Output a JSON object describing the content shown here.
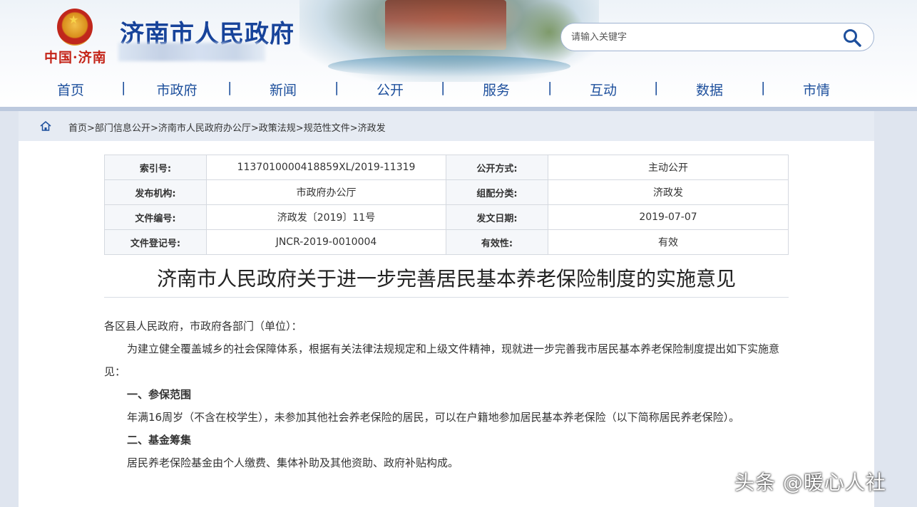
{
  "header": {
    "site_title": "济南市人民政府",
    "logo_text": "中国·济南",
    "search_placeholder": "请输入关键字"
  },
  "nav": {
    "items": [
      "首页",
      "市政府",
      "新闻",
      "公开",
      "服务",
      "互动",
      "数据",
      "市情"
    ],
    "separator": "|"
  },
  "breadcrumb": {
    "items": [
      "首页",
      "部门信息公开",
      "济南市人民政府办公厅",
      "政策法规",
      "规范性文件",
      "济政发"
    ],
    "separator": ">"
  },
  "meta": {
    "rows": [
      {
        "k1": "索引号:",
        "v1": "1137010000418859XL/2019-11319",
        "k2": "公开方式:",
        "v2": "主动公开"
      },
      {
        "k1": "发布机构:",
        "v1": "市政府办公厅",
        "k2": "组配分类:",
        "v2": "济政发"
      },
      {
        "k1": "文件编号:",
        "v1": "济政发〔2019〕11号",
        "k2": "发文日期:",
        "v2": "2019-07-07"
      },
      {
        "k1": "文件登记号:",
        "v1": "JNCR-2019-0010004",
        "k2": "有效性:",
        "v2": "有效"
      }
    ]
  },
  "document": {
    "title": "济南市人民政府关于进一步完善居民基本养老保险制度的实施意见",
    "salutation": "各区县人民政府，市政府各部门（单位）：",
    "para1": "为建立健全覆盖城乡的社会保障体系，根据有关法律法规规定和上级文件精神，现就进一步完善我市居民基本养老保险制度提出如下实施意见：",
    "h1": "一、参保范围",
    "para2": "年满16周岁（不含在校学生），未参加其他社会养老保险的居民，可以在户籍地参加居民基本养老保险（以下简称居民养老保险）。",
    "h2": "二、基金筹集",
    "para3": "居民养老保险基金由个人缴费、集体补助及其他资助、政府补贴构成。"
  },
  "watermark": "头条 @暖心人社",
  "colors": {
    "nav_text": "#1d4f9c",
    "site_title": "#17439a",
    "logo_red": "#c42418"
  }
}
